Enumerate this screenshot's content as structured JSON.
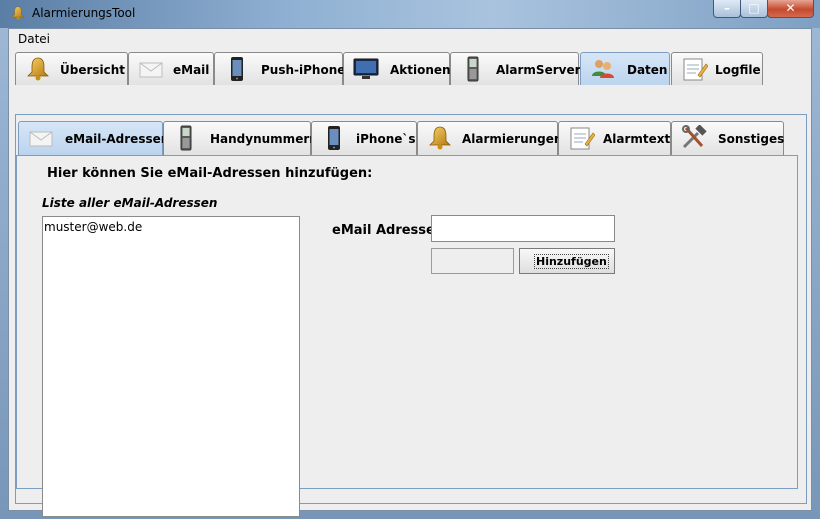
{
  "window": {
    "title": "AlarmierungsTool",
    "controls": {
      "minimize": "–",
      "maximize": "□",
      "close": "✕"
    }
  },
  "menubar": {
    "items": [
      {
        "label": "Datei"
      }
    ]
  },
  "main_tabs": [
    {
      "label": "Übersicht",
      "icon": "bell-icon",
      "active": false
    },
    {
      "label": "eMail",
      "icon": "envelope-icon",
      "active": false
    },
    {
      "label": "Push-iPhone",
      "icon": "iphone-icon",
      "active": false
    },
    {
      "label": "Aktionen",
      "icon": "monitor-icon",
      "active": false
    },
    {
      "label": "AlarmServer",
      "icon": "mobile-phone-icon",
      "active": false
    },
    {
      "label": "Daten",
      "icon": "users-icon",
      "active": true
    },
    {
      "label": "Logfile",
      "icon": "notepad-icon",
      "active": false
    }
  ],
  "sub_tabs": [
    {
      "label": "eMail-Adressen",
      "icon": "envelope-icon",
      "active": true
    },
    {
      "label": "Handynummern",
      "icon": "mobile-phone-icon",
      "active": false
    },
    {
      "label": "iPhone`s",
      "icon": "iphone-icon",
      "active": false
    },
    {
      "label": "Alarmierungen",
      "icon": "bell-icon",
      "active": false
    },
    {
      "label": "Alarmtext",
      "icon": "notepad-icon",
      "active": false
    },
    {
      "label": "Sonstiges",
      "icon": "tools-icon",
      "active": false
    }
  ],
  "content": {
    "heading": "Hier können Sie eMail-Adressen hinzufügen:",
    "list_label": "Liste aller eMail-Adressen",
    "list_items": [
      "muster@web.de"
    ],
    "email_label": "eMail Adresse",
    "email_value": "",
    "add_button": "Hinzufügen"
  },
  "colors": {
    "active_tab": "#c6dcf2",
    "accent_border": "#7d9cc2",
    "panel": "#eeeeee"
  }
}
